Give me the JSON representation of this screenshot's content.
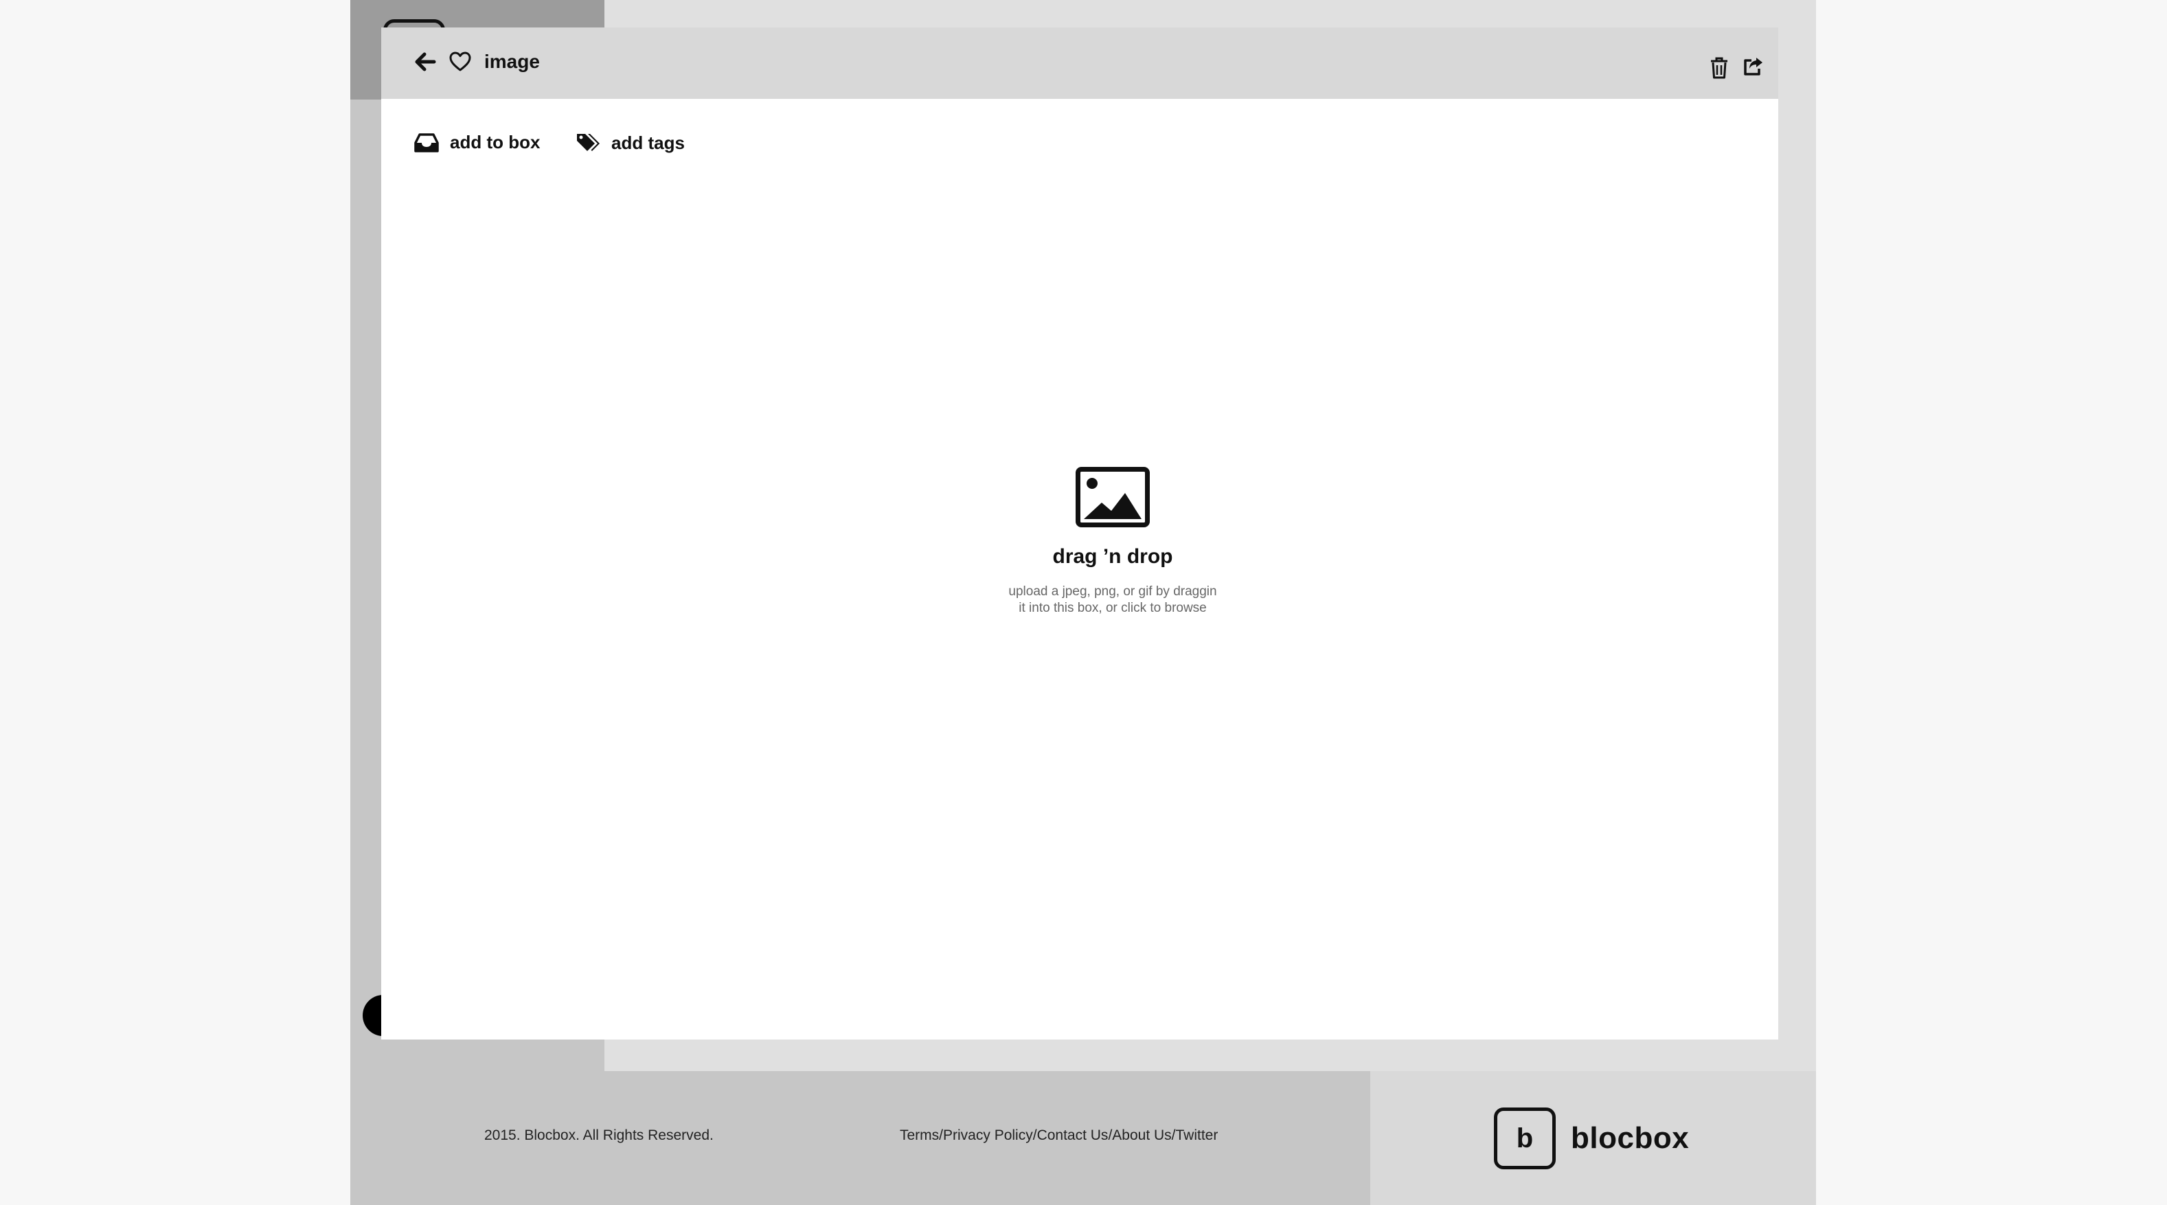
{
  "header": {
    "title": "image",
    "icons": [
      "arrow-left-icon",
      "heart-icon",
      "trash-icon",
      "share-icon"
    ]
  },
  "toolbar": {
    "add_to_box": "add to box",
    "add_tags": "add tags"
  },
  "dropzone": {
    "title": "drag ’n drop",
    "line1": "upload a jpeg, png, or gif by draggin",
    "line2": "it into this box, or click to browse"
  },
  "footer": {
    "copyright": "2015. Blocbox. All Rights Reserved.",
    "links": [
      "Terms",
      "Privacy Policy",
      "Contact Us",
      "About Us",
      "Twitter"
    ],
    "separator": "/",
    "brand_letter": "b",
    "brand_name": "blocbox"
  },
  "colors": {
    "page_bg": "#f7f7f7",
    "app_bg": "#e0e0e0",
    "sidebar": "#c6c6c6",
    "header": "#d8d8d8",
    "modal": "#ffffff",
    "text": "#111111"
  }
}
